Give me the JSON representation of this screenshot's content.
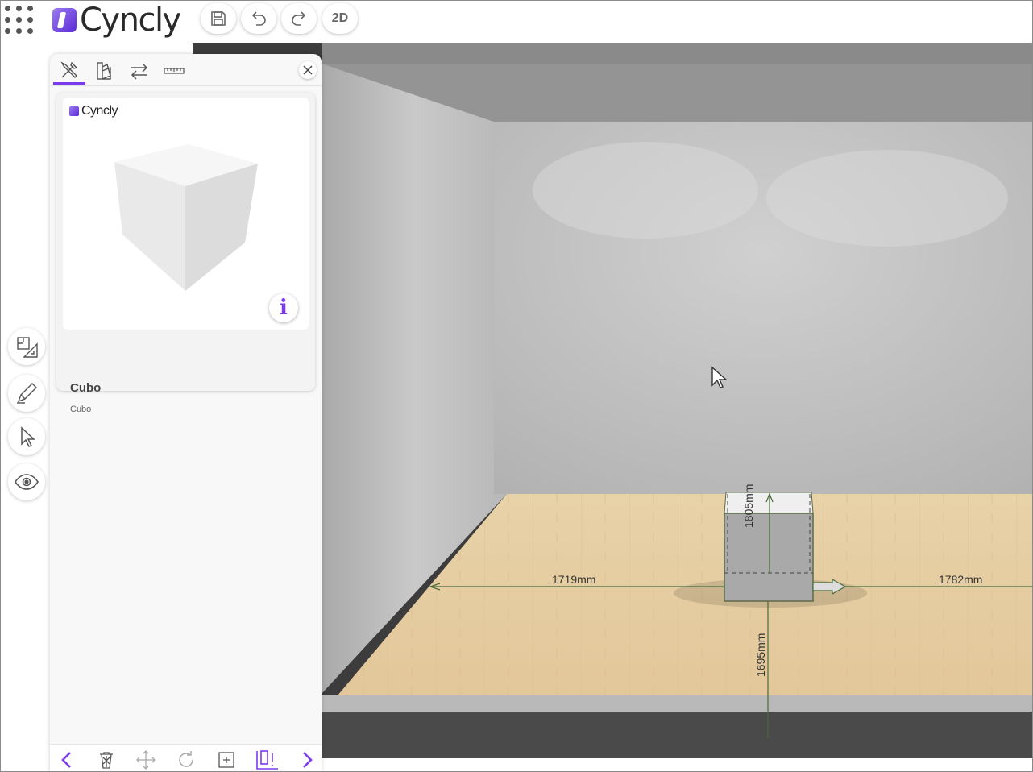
{
  "app": {
    "brand": "Cyncly"
  },
  "toolbar": {
    "save_icon": "save-icon",
    "undo_icon": "undo-icon",
    "redo_icon": "redo-icon",
    "view_toggle_label": "2D"
  },
  "side_tools": [
    {
      "icon": "floorplan-icon"
    },
    {
      "icon": "pencil-icon"
    },
    {
      "icon": "pointer-icon"
    },
    {
      "icon": "eye-icon"
    }
  ],
  "panel": {
    "tabs": [
      {
        "icon": "tools-icon",
        "active": true
      },
      {
        "icon": "palette-icon",
        "active": false
      },
      {
        "icon": "swap-icon",
        "active": false
      },
      {
        "icon": "ruler-icon",
        "active": false
      }
    ],
    "product": {
      "brand": "Cyncly",
      "title": "Cubo",
      "subtitle": "Cubo"
    },
    "bottom_actions": [
      "chevron-left-icon",
      "trash-icon",
      "move-icon",
      "rotate-icon",
      "add-icon",
      "align-icon",
      "chevron-right-icon"
    ]
  },
  "scene": {
    "dimensions": {
      "left": "1719mm",
      "right": "1782mm",
      "height": "1805mm",
      "front": "1695mm"
    },
    "accent_color": "#7c3aed",
    "dimension_line_color": "#4a6a3a"
  }
}
